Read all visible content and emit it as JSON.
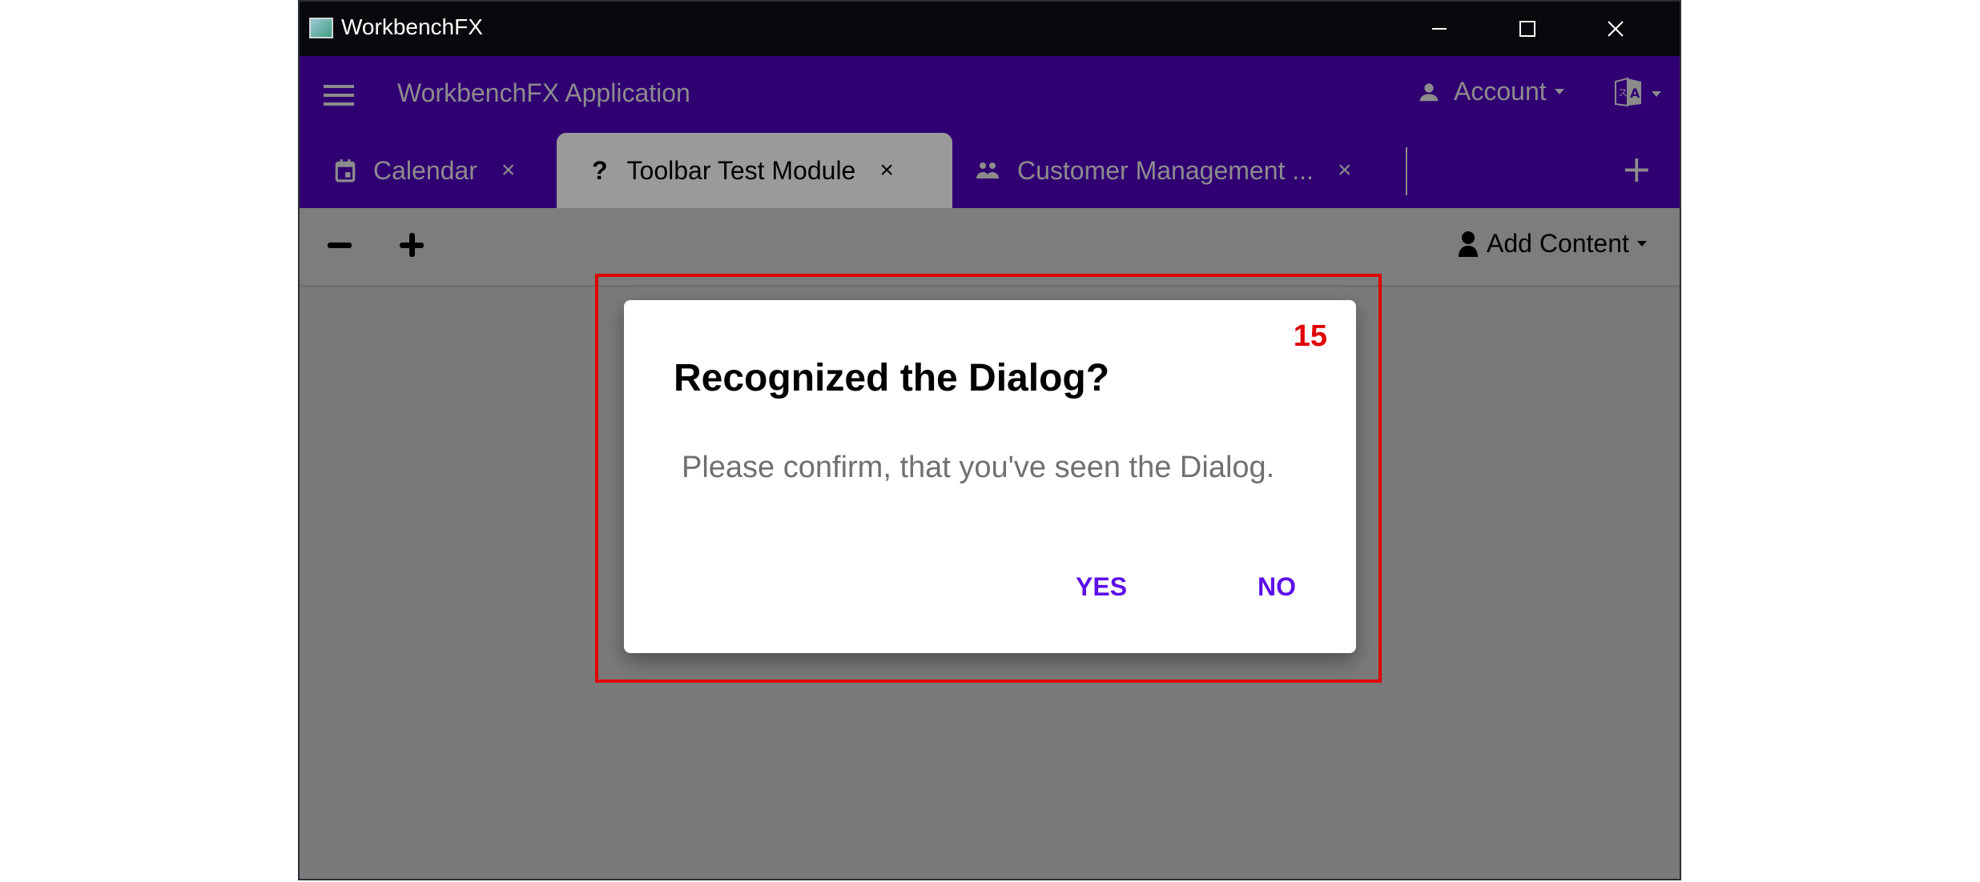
{
  "window": {
    "title": "WorkbenchFX",
    "controls": {
      "minimize": "minimize-icon",
      "maximize": "maximize-icon",
      "close": "close-icon"
    }
  },
  "appbar": {
    "menu_icon": "hamburger-menu-icon",
    "title": "WorkbenchFX Application",
    "account_label": "Account",
    "account_icon": "person-icon",
    "language_icon": "translate-icon"
  },
  "tabs": [
    {
      "label": "Calendar",
      "icon": "calendar-icon",
      "close": "×",
      "active": false
    },
    {
      "label": "Toolbar Test Module",
      "icon": "?",
      "close": "×",
      "active": true
    },
    {
      "label": "Customer Management ...",
      "icon": "people-icon",
      "close": "×",
      "active": false
    }
  ],
  "add_tab": "+",
  "toolbar": {
    "remove_icon": "minus-icon",
    "add_icon": "plus-icon",
    "add_content_label": "Add Content",
    "add_content_icon": "user-icon"
  },
  "dialog": {
    "badge": "15",
    "title": "Recognized the Dialog?",
    "message": "Please confirm, that you've seen the Dialog.",
    "yes_label": "YES",
    "no_label": "NO"
  },
  "colors": {
    "accent": "#300073",
    "button_text": "#5d10e8",
    "highlight": "#e00000"
  }
}
